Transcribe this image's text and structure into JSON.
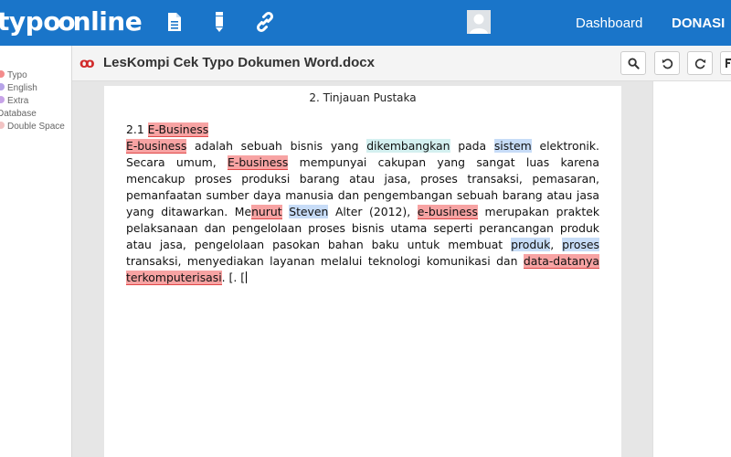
{
  "brand": {
    "logo_text_a": "typ",
    "logo_text_b": "oo",
    "logo_text_c": "nline"
  },
  "topbar": {
    "icons": [
      "document-icon",
      "pencil-icon",
      "link-icon"
    ],
    "nav": {
      "dashboard": "Dashboard",
      "donasi": "DONASI"
    },
    "color": "#1a75c9"
  },
  "legend": [
    {
      "label": "Typo",
      "color": "#f48c8c"
    },
    {
      "label": "English",
      "color": "#b6a3e8"
    },
    {
      "label": "Extra",
      "color": "#c7a3e8"
    },
    {
      "label": "Database",
      "color": null
    },
    {
      "label": "Double Space",
      "color": "#f2c4c4"
    }
  ],
  "document": {
    "title": "LesKompi Cek Typo Dokumen Word.docx",
    "heading": "2. Tinjauan Pustaka",
    "section_number": "2.1 ",
    "section_title": "E-Business",
    "paragraph": [
      {
        "t": "E-business",
        "k": "typo"
      },
      {
        "t": " adalah sebuah bisnis yang "
      },
      {
        "t": "dikembangkan",
        "k": "extra"
      },
      {
        "t": " pada "
      },
      {
        "t": "sistem",
        "k": "eng"
      },
      {
        "t": " elektronik. Secara umum, "
      },
      {
        "t": "E-business",
        "k": "typo"
      },
      {
        "t": " mempunyai cakupan yang sangat luas karena mencakup proses produksi barang atau jasa, proses transaksi, pemasaran, pemanfaatan sumber daya manusia dan pengembangan sebuah barang atau jasa yang ditawarkan. Me"
      },
      {
        "t": "nurut",
        "k": "typo"
      },
      {
        "t": " "
      },
      {
        "t": "Steven",
        "k": "eng"
      },
      {
        "t": " Alter (2012), "
      },
      {
        "t": "e-business",
        "k": "typo"
      },
      {
        "t": " merupakan praktek pelaksanaan dan pengelolaan proses bisnis utama seperti perancangan produk atau jasa, pengelolaan pasokan bahan baku untuk membuat "
      },
      {
        "t": "produk",
        "k": "eng"
      },
      {
        "t": ", "
      },
      {
        "t": "proses",
        "k": "eng"
      },
      {
        "t": " transaksi, menyediakan layanan melalui teknologi komunikasi dan "
      },
      {
        "t": "data-datanya",
        "k": "typo"
      },
      {
        "t": " "
      },
      {
        "t": "terkomputerisasi",
        "k": "typo"
      },
      {
        "t": ". [. ["
      }
    ]
  },
  "toolbar": {
    "buttons": [
      "search-icon",
      "undo-icon",
      "redo-icon",
      "more-icon"
    ]
  }
}
